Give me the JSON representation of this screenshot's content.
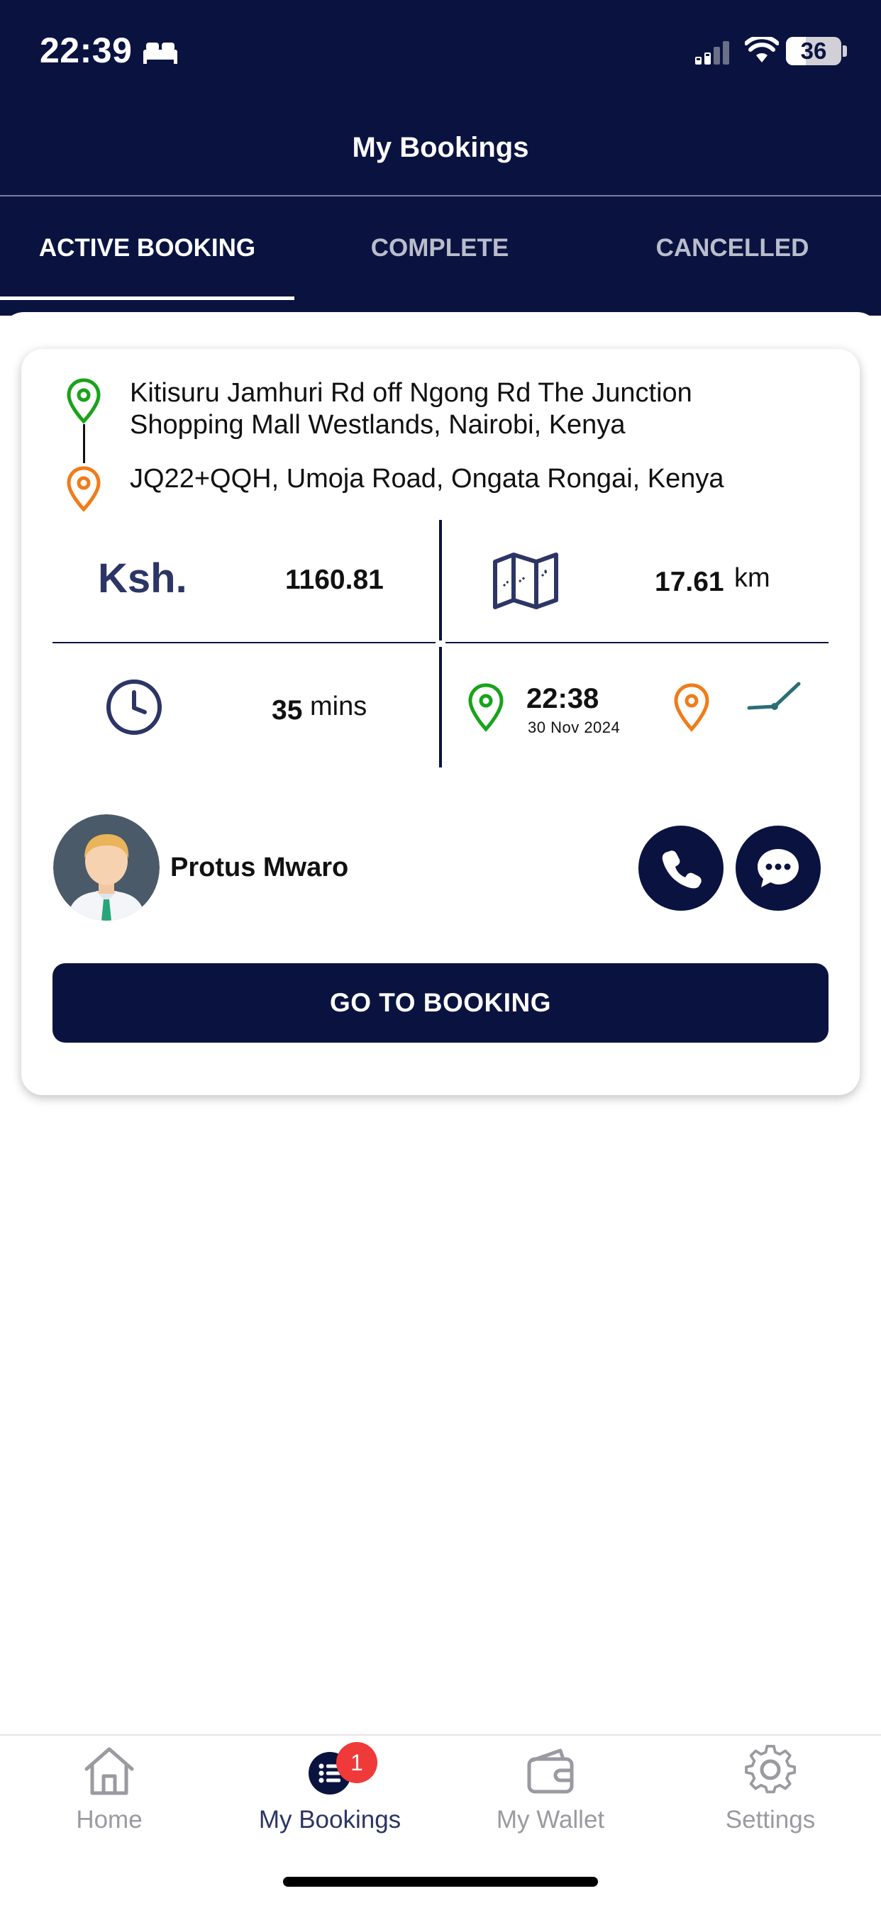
{
  "status_bar": {
    "time": "22:39",
    "battery": "36",
    "battery_level": 0.36
  },
  "header": {
    "title": "My Bookings"
  },
  "tabs": [
    {
      "label": "ACTIVE BOOKING",
      "active": true
    },
    {
      "label": "COMPLETE",
      "active": false
    },
    {
      "label": "CANCELLED",
      "active": false
    }
  ],
  "booking": {
    "pickup_address": "Kitisuru Jamhuri Rd off Ngong Rd The Junction Shopping Mall Westlands, Nairobi, Kenya",
    "dropoff_address": "JQ22+QQH, Umoja Road, Ongata Rongai, Kenya",
    "currency": "Ksh.",
    "fare": "1160.81",
    "distance": "17.61",
    "distance_unit": "km",
    "duration": "35",
    "duration_unit": "mins",
    "pickup_time": "22:38",
    "pickup_date": "30 Nov 2024",
    "driver_name": "Protus Mwaro",
    "cta_label": "GO TO BOOKING"
  },
  "bottom_nav": {
    "items": [
      {
        "label": "Home",
        "icon": "home-icon",
        "active": false
      },
      {
        "label": "My Bookings",
        "icon": "list-icon",
        "active": true,
        "badge": "1"
      },
      {
        "label": "My Wallet",
        "icon": "wallet-icon",
        "active": false
      },
      {
        "label": "Settings",
        "icon": "gear-icon",
        "active": false
      }
    ]
  },
  "colors": {
    "primary": "#0a1340",
    "pickup_pin": "#19a31a",
    "dropoff_pin": "#f07c1a",
    "badge": "#f03a3a",
    "route_line": "#2c6e75"
  }
}
